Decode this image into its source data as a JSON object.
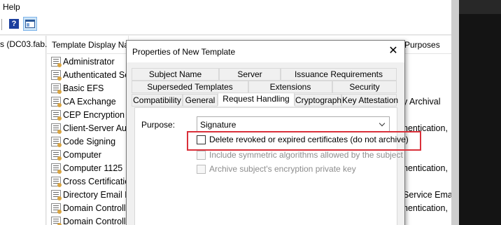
{
  "menu": {
    "help_label": "Help"
  },
  "toolbar": {
    "help_icon": "help-book-icon",
    "view_icon": "show-hide-console-tree-icon"
  },
  "tree": {
    "node_label": "s (DC03.fab."
  },
  "list": {
    "columns": {
      "name": "Template Display Na",
      "purposes": "Purposes"
    },
    "rows": [
      {
        "name": "Administrator",
        "purpose": ""
      },
      {
        "name": "Authenticated Se",
        "purpose": ""
      },
      {
        "name": "Basic EFS",
        "purpose": ""
      },
      {
        "name": "CA Exchange",
        "purpose": "y Archival"
      },
      {
        "name": "CEP Encryption",
        "purpose": ""
      },
      {
        "name": "Client-Server Aut",
        "purpose": "hentication,"
      },
      {
        "name": "Code Signing",
        "purpose": ""
      },
      {
        "name": "Computer",
        "purpose": ""
      },
      {
        "name": "Computer 1125",
        "purpose": "hentication,"
      },
      {
        "name": "Cross Certificatio",
        "purpose": ""
      },
      {
        "name": "Directory Email R",
        "purpose": "Service Email"
      },
      {
        "name": "Domain Controll",
        "purpose": "hentication,"
      },
      {
        "name": "Domain Controll",
        "purpose": ""
      }
    ]
  },
  "dialog": {
    "title": "Properties of New Template",
    "close_label": "✕",
    "tabs_row1": [
      "Subject Name",
      "Server",
      "Issuance Requirements"
    ],
    "tabs_row2": [
      "Superseded Templates",
      "Extensions",
      "Security"
    ],
    "tabs_row3": [
      "Compatibility",
      "General",
      "Request Handling",
      "Cryptography",
      "Key Attestation"
    ],
    "active_tab": "Request Handling",
    "purpose_label": "Purpose:",
    "purpose_value": "Signature",
    "checkboxes": [
      {
        "label": "Delete revoked or expired certificates (do not archive)",
        "checked": false,
        "enabled": true
      },
      {
        "label": "Include symmetric algorithms allowed by the subject",
        "checked": false,
        "enabled": false
      },
      {
        "label": "Archive subject's encryption private key",
        "checked": false,
        "enabled": false
      }
    ]
  },
  "annotation": {
    "color": "#d9303a"
  }
}
